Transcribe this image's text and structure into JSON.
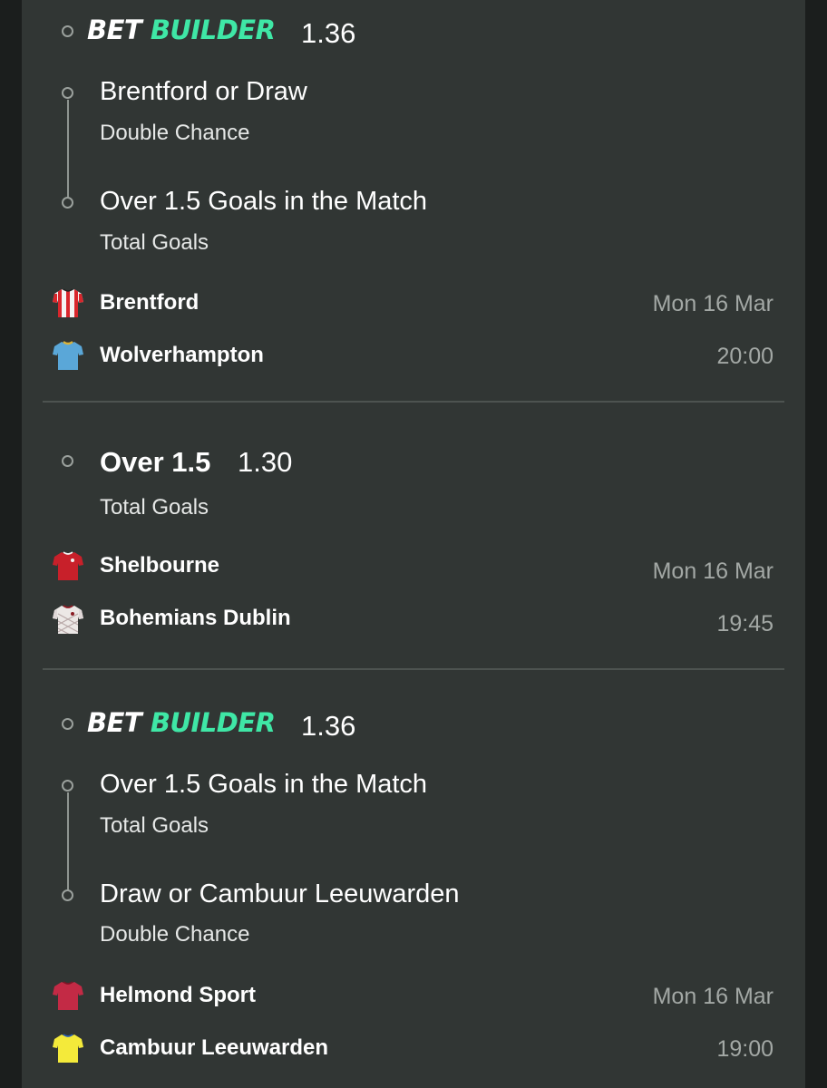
{
  "colors": {
    "background": "#1b1e1d",
    "panel": "#313634",
    "builder_accent": "#3fe7a6",
    "muted_text": "#a3a8a5",
    "divider": "#4d5350"
  },
  "bets": [
    {
      "header": {
        "bet": "BET",
        "builder": "BUILDER",
        "odds": "1.36"
      },
      "selections": [
        {
          "title": "Brentford or Draw",
          "market": "Double Chance"
        },
        {
          "title": "Over 1.5 Goals in the Match",
          "market": "Total Goals"
        }
      ],
      "home_team": {
        "name": "Brentford",
        "shirt_icon": "striped-red-white-shirt-icon"
      },
      "away_team": {
        "name": "Wolverhampton",
        "shirt_icon": "light-blue-shirt-icon"
      },
      "date": "Mon 16 Mar",
      "time": "20:00"
    },
    {
      "selection": {
        "title": "Over 1.5",
        "odds": "1.30",
        "market": "Total Goals"
      },
      "home_team": {
        "name": "Shelbourne",
        "shirt_icon": "red-shirt-icon"
      },
      "away_team": {
        "name": "Bohemians Dublin",
        "shirt_icon": "white-patterned-shirt-icon"
      },
      "date": "Mon 16 Mar",
      "time": "19:45"
    },
    {
      "header": {
        "bet": "BET",
        "builder": "BUILDER",
        "odds": "1.36"
      },
      "selections": [
        {
          "title": "Over 1.5 Goals in the Match",
          "market": "Total Goals"
        },
        {
          "title": "Draw or Cambuur Leeuwarden",
          "market": "Double Chance"
        }
      ],
      "home_team": {
        "name": "Helmond Sport",
        "shirt_icon": "crimson-shirt-icon"
      },
      "away_team": {
        "name": "Cambuur Leeuwarden",
        "shirt_icon": "yellow-shirt-icon"
      },
      "date": "Mon 16 Mar",
      "time": "19:00"
    }
  ]
}
